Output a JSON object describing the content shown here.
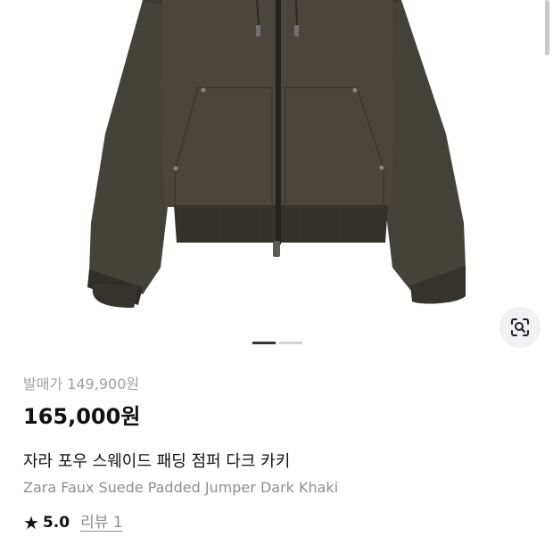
{
  "product": {
    "release_price": "발매가 149,900원",
    "price": "165,000원",
    "name_ko": "자라 포우 스웨이드 패딩 점퍼 다크 카키",
    "name_en": "Zara Faux Suede Padded Jumper Dark Khaki",
    "rating": "5.0",
    "reviews_label": "리뷰 1"
  },
  "gallery": {
    "image_count": 2,
    "active_index": 0,
    "jacket_color": "#45423a"
  },
  "icons": {
    "rating": "star-icon",
    "image_search": "image-search-icon"
  }
}
